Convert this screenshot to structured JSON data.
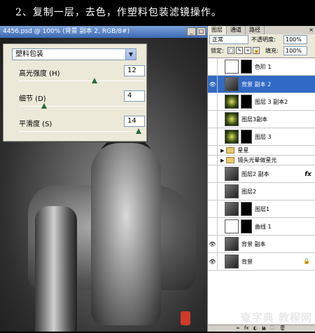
{
  "caption": "2、复制一层，去色，作塑料包装滤镜操作。",
  "document": {
    "title": "4456.psd @ 100% (背景 副本 2, RGB/8#)",
    "min_label": "_",
    "max_label": "□",
    "close_label": "×"
  },
  "dialog": {
    "filter_name": "塑料包装",
    "dropdown_arrow": "▼",
    "params": [
      {
        "label": "高光强度 (H)",
        "value": "12",
        "level_fraction": 0.6
      },
      {
        "label": "细节 (D)",
        "value": "4",
        "level_fraction": 0.2
      },
      {
        "label": "平滑度 (S)",
        "value": "14",
        "level_fraction": 0.95
      }
    ]
  },
  "panel": {
    "tabs": [
      "图层",
      "通道",
      "路径"
    ],
    "close_label": "×",
    "blend_mode": "正常",
    "opacity_label": "不透明度:",
    "opacity_value": "100%",
    "lock_label": "锁定:",
    "lock_icons": [
      "□",
      "✎",
      "+",
      "🔒"
    ],
    "fill_label": "填充:",
    "fill_value": "100%",
    "layers": [
      {
        "name": "色阶 1",
        "thumb": "levels",
        "mask": true,
        "visible": false,
        "selected": false
      },
      {
        "name": "背景 副本 2",
        "thumb": "dark",
        "mask": false,
        "visible": true,
        "selected": true
      },
      {
        "name": "图层 3 副本2",
        "thumb": "green",
        "mask": true,
        "visible": false,
        "selected": false
      },
      {
        "name": "图层3副本",
        "thumb": "green",
        "mask": false,
        "visible": false,
        "selected": false
      },
      {
        "name": "图层 3",
        "thumb": "green",
        "mask": true,
        "visible": false,
        "selected": false
      },
      {
        "name": "星星",
        "group": true,
        "visible": false
      },
      {
        "name": "镜头光晕做星光",
        "group": true,
        "visible": false
      },
      {
        "name": "图层2 副本",
        "thumb": "dark",
        "mask": false,
        "visible": false,
        "fx": "fx",
        "selected": false
      },
      {
        "name": "图层2",
        "thumb": "dark",
        "mask": false,
        "visible": false,
        "selected": false
      },
      {
        "name": "图层1",
        "thumb": "dark",
        "mask": true,
        "visible": false,
        "selected": false
      },
      {
        "name": "曲线 1",
        "thumb": "curve",
        "mask": true,
        "visible": false,
        "selected": false
      },
      {
        "name": "背景 副本",
        "thumb": "dark",
        "mask": false,
        "visible": true,
        "selected": false
      },
      {
        "name": "背景",
        "thumb": "dark",
        "mask": false,
        "visible": true,
        "locked": true,
        "selected": false
      }
    ],
    "bottom_icons": [
      "∞",
      "fx",
      "◐",
      "▣",
      "🗀",
      "🗑"
    ]
  },
  "watermark": {
    "main": "查字典 教程网",
    "url": "jiaocheng.chazidian.com"
  },
  "icons": {
    "eye": "👁",
    "chain": "8",
    "folder_arrow": "▶",
    "lock": "🔒"
  },
  "colors": {
    "selection": "#316ac5",
    "titlebar": "#3b6ab5",
    "slider_thumb": "#2a6a3a"
  }
}
